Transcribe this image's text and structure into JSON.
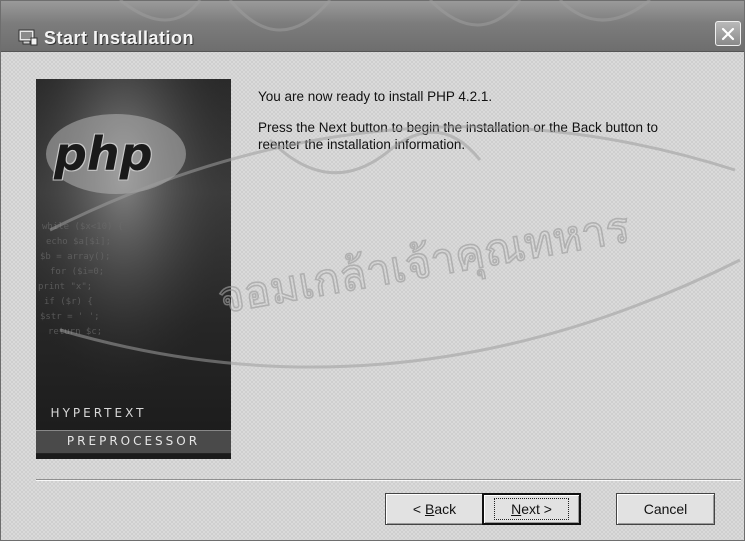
{
  "window": {
    "title": "Start Installation",
    "close_symbol": "✕"
  },
  "side_panel": {
    "logo_text": "php",
    "line1": "HYPERTEXT",
    "line2": "PREPROCESSOR"
  },
  "content": {
    "heading": "You are now ready to install PHP 4.2.1.",
    "body": "Press the Next button to begin the installation or the Back button to reenter the installation information."
  },
  "buttons": {
    "back_prefix": "< ",
    "back_mnemonic": "B",
    "back_rest": "ack",
    "next_mnemonic": "N",
    "next_rest": "ext >",
    "cancel": "Cancel"
  },
  "watermark": {
    "text": "จอมเกล้าเจ้าคุณทหาร",
    "color": "#9e9e9e"
  }
}
